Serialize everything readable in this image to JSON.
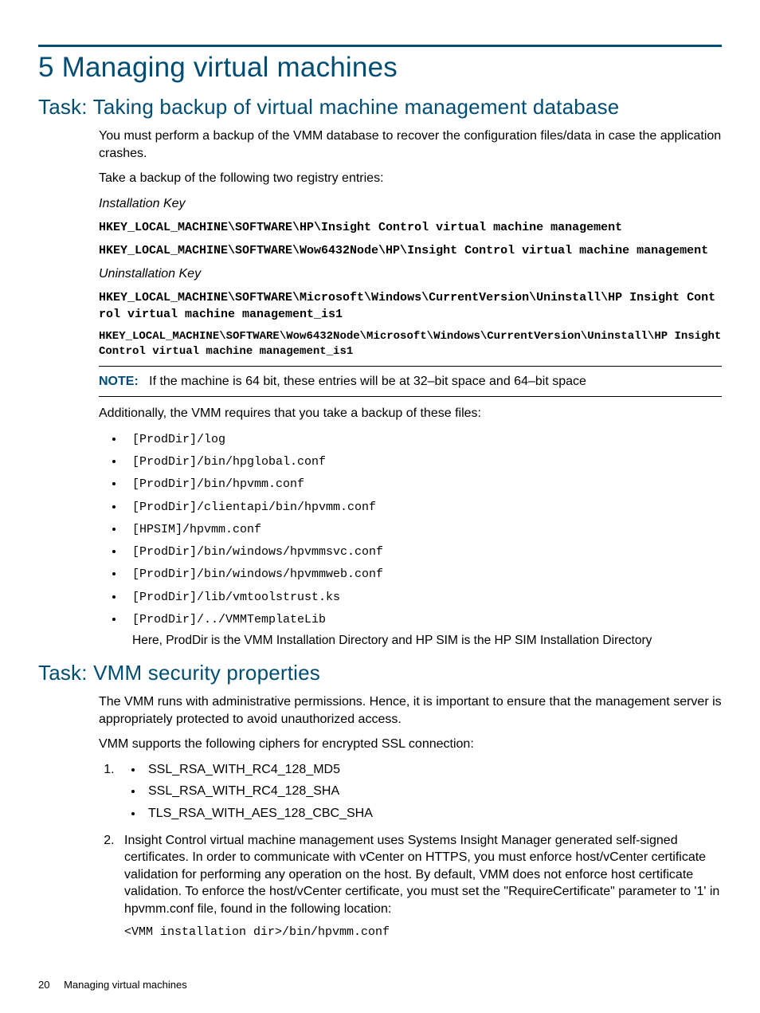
{
  "chapter": {
    "number": "5",
    "title": "Managing virtual machines"
  },
  "task1": {
    "heading": "Task: Taking backup of virtual machine management database",
    "p1": "You must perform a backup of the VMM database to recover the configuration files/data in case the application crashes.",
    "p2": "Take a backup of the following two registry entries:",
    "installKeyLabel": "Installation Key",
    "installKey1": "HKEY_LOCAL_MACHINE\\SOFTWARE\\HP\\Insight Control virtual machine management",
    "installKey2": "HKEY_LOCAL_MACHINE\\SOFTWARE\\Wow6432Node\\HP\\Insight Control virtual machine management",
    "uninstallKeyLabel": "Uninstallation Key",
    "uninstallKey1": "HKEY_LOCAL_MACHINE\\SOFTWARE\\Microsoft\\Windows\\CurrentVersion\\Uninstall\\HP Insight Control virtual machine management_is1",
    "uninstallKey2": "HKEY_LOCAL_MACHINE\\SOFTWARE\\Wow6432Node\\Microsoft\\Windows\\CurrentVersion\\Uninstall\\HP Insight Control virtual machine management_is1",
    "noteLabel": "NOTE:",
    "noteText": "If the machine is 64 bit, these entries will be at 32–bit space and 64–bit space",
    "p3": "Additionally, the VMM requires that you take a backup of these files:",
    "files": [
      "[ProdDir]/log",
      "[ProdDir]/bin/hpglobal.conf",
      "[ProdDir]/bin/hpvmm.conf",
      "[ProdDir]/clientapi/bin/hpvmm.conf",
      "[HPSIM]/hpvmm.conf",
      "[ProdDir]/bin/windows/hpvmmsvc.conf",
      "[ProdDir]/bin/windows/hpvmmweb.conf",
      "[ProdDir]/lib/vmtoolstrust.ks",
      "[ProdDir]/../VMMTemplateLib"
    ],
    "filesNote": "Here, ProdDir is the VMM Installation Directory and HP SIM is the HP SIM Installation Directory"
  },
  "task2": {
    "heading": "Task: VMM security properties",
    "p1": "The VMM runs with administrative permissions. Hence, it is important to ensure that the management server is appropriately protected to avoid unauthorized access.",
    "p2": "VMM supports the following ciphers for encrypted SSL connection:",
    "ciphers": [
      "SSL_RSA_WITH_RC4_128_MD5",
      "SSL_RSA_WITH_RC4_128_SHA",
      "TLS_RSA_WITH_AES_128_CBC_SHA"
    ],
    "item2": "Insight Control virtual machine management uses Systems Insight Manager generated self-signed certificates. In order to communicate with vCenter on HTTPS, you must enforce host/vCenter certificate validation for performing any operation on the host. By default, VMM does not enforce host certificate validation. To enforce the host/vCenter certificate, you must set the \"RequireCertificate\" parameter to '1' in hpvmm.conf file, found in the following location:",
    "item2path": "<VMM installation dir>/bin/hpvmm.conf"
  },
  "footer": {
    "page": "20",
    "title": "Managing virtual machines"
  }
}
